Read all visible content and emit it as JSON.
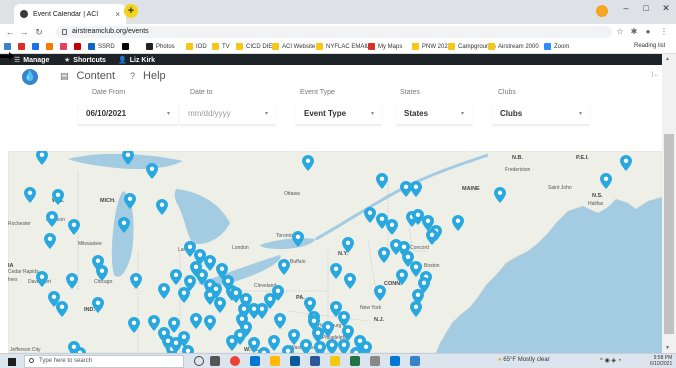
{
  "browser": {
    "tab_title": "Event Calendar | ACI",
    "tab_close": "×",
    "new_tab": "+",
    "url": "airstreamclub.org/events",
    "window_controls": [
      "–",
      "□",
      "✕"
    ],
    "reading_list": "Reading list"
  },
  "bookmarks": [
    {
      "label": "",
      "color": "#3b83c8"
    },
    {
      "label": "",
      "color": "#d93025"
    },
    {
      "label": "",
      "color": "#1a73e8"
    },
    {
      "label": "",
      "color": "#f27b00"
    },
    {
      "label": "",
      "color": "#e4405f"
    },
    {
      "label": "",
      "color": "#c00000"
    },
    {
      "label": "SSRD",
      "color": "#0a66c2"
    },
    {
      "label": "",
      "color": "#000000"
    },
    {
      "label": "Photos",
      "color": "#222222"
    },
    {
      "label": "IOD",
      "color": "#f5c518"
    },
    {
      "label": "TV",
      "color": "#f5c518"
    },
    {
      "label": "CICD DIET",
      "color": "#f5c518"
    },
    {
      "label": "ACI Website",
      "color": "#f5c518"
    },
    {
      "label": "NYFLAC EMAIL",
      "color": "#f5c518"
    },
    {
      "label": "My Maps",
      "color": "#d93025"
    },
    {
      "label": "PNW 2021",
      "color": "#f5c518"
    },
    {
      "label": "Campgrounds",
      "color": "#f5c518"
    },
    {
      "label": "Airstream 2000",
      "color": "#f5c518"
    },
    {
      "label": "Zoom",
      "color": "#2d8cff"
    }
  ],
  "admin_bar": {
    "manage": "Manage",
    "shortcuts": "Shortcuts",
    "user": "Liz Kirk"
  },
  "site_nav": {
    "content": "Content",
    "help": "Help",
    "right_mark": "|←"
  },
  "filters": {
    "date_from_label": "Date From",
    "date_from_value": "06/10/2021",
    "date_to_label": "Date to",
    "date_to_placeholder": "mm/dd/yyyy",
    "event_type_label": "Event Type",
    "event_type_value": "Event Type",
    "states_label": "States",
    "states_value": "States",
    "clubs_label": "Clubs",
    "clubs_value": "Clubs"
  },
  "map": {
    "labels": [
      {
        "text": "WIS.",
        "bold": true
      },
      {
        "text": "MICH.",
        "bold": true
      },
      {
        "text": "Ottawa",
        "bold": false
      },
      {
        "text": "MAINE",
        "bold": true
      },
      {
        "text": "N.B.",
        "bold": true
      },
      {
        "text": "P.E.I.",
        "bold": true
      },
      {
        "text": "Fredericton",
        "bold": false
      },
      {
        "text": "Saint John",
        "bold": false
      },
      {
        "text": "N.S.",
        "bold": true
      },
      {
        "text": "Halifax",
        "bold": false
      },
      {
        "text": "Rochester",
        "bold": false
      },
      {
        "text": "Madison",
        "bold": false
      },
      {
        "text": "Milwaukee",
        "bold": false
      },
      {
        "text": "Lansing",
        "bold": false
      },
      {
        "text": "London",
        "bold": false
      },
      {
        "text": "Toronto",
        "bold": false
      },
      {
        "text": "Buffalo",
        "bold": false
      },
      {
        "text": "N.Y.",
        "bold": true
      },
      {
        "text": "Concord",
        "bold": false
      },
      {
        "text": "Boston",
        "bold": false
      },
      {
        "text": "Cedar Rapids",
        "bold": false
      },
      {
        "text": "Davenport",
        "bold": false
      },
      {
        "text": "Chicago",
        "bold": false
      },
      {
        "text": "Toledo",
        "bold": false
      },
      {
        "text": "Cleveland",
        "bold": false
      },
      {
        "text": "PA.",
        "bold": true
      },
      {
        "text": "CONN.",
        "bold": true
      },
      {
        "text": "New York",
        "bold": false
      },
      {
        "text": "N.J.",
        "bold": true
      },
      {
        "text": "Harrisburg",
        "bold": false
      },
      {
        "text": "Philadelphia",
        "bold": false
      },
      {
        "text": "IND.",
        "bold": true
      },
      {
        "text": "W.VA.",
        "bold": true
      },
      {
        "text": "Cincinnati",
        "bold": false
      },
      {
        "text": "Washington",
        "bold": false
      },
      {
        "text": "Jefferson City",
        "bold": false
      },
      {
        "text": "IA",
        "bold": true
      },
      {
        "text": "Ines",
        "bold": false
      }
    ],
    "pin_count": 118
  },
  "taskbar": {
    "search_placeholder": "Type here to search",
    "weather": "65°F  Mostly clear",
    "time": "9:58 PM",
    "date": "6/10/2021"
  },
  "colors": {
    "pin": "#29a8e0",
    "admin_bar": "#1d2327",
    "map_water": "#a3cbe1",
    "map_land": "#eef0e8",
    "logo": "#3b83c8"
  }
}
